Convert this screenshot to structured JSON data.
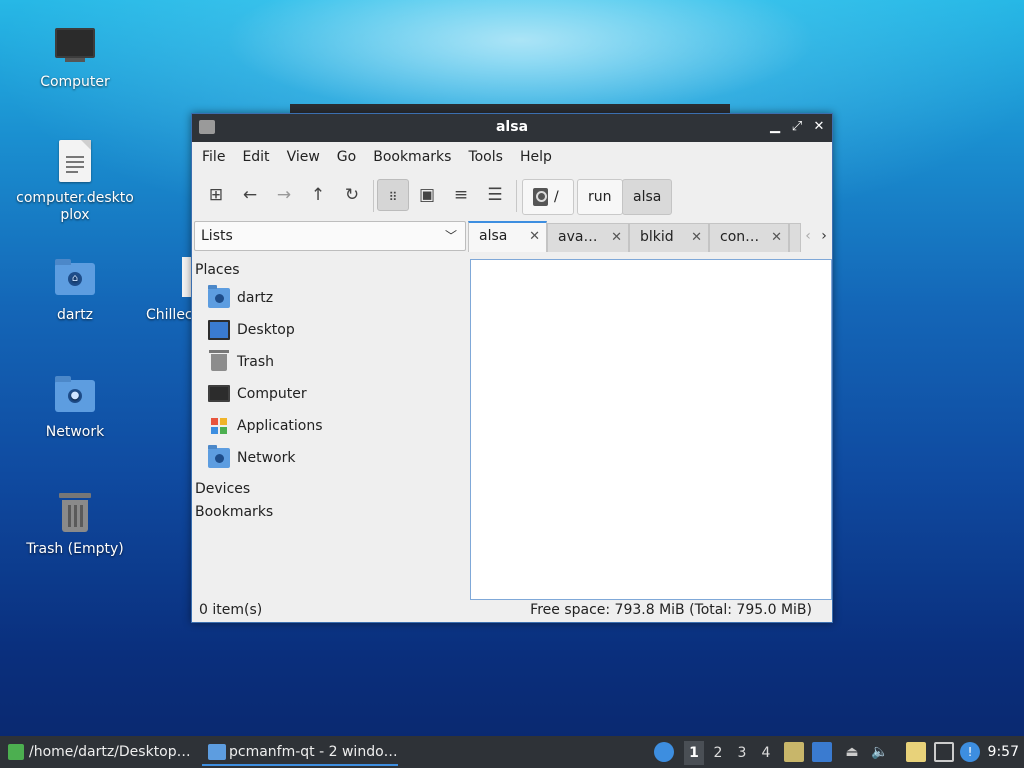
{
  "desktop": {
    "icons": [
      {
        "label": "Computer"
      },
      {
        "label": "computer.desktoplox"
      },
      {
        "label": "dartz"
      },
      {
        "label": "Chillec"
      },
      {
        "label": "Network"
      },
      {
        "label": "Trash (Empty)"
      }
    ]
  },
  "window": {
    "title": "alsa",
    "menu": [
      "File",
      "Edit",
      "View",
      "Go",
      "Bookmarks",
      "Tools",
      "Help"
    ],
    "pathbar": {
      "root": "/",
      "crumbs": [
        "run",
        "alsa"
      ]
    },
    "side_pane_mode": "Lists",
    "tabs": [
      {
        "label": "alsa"
      },
      {
        "label": "ava…"
      },
      {
        "label": "blkid"
      },
      {
        "label": "con…"
      }
    ],
    "sidebar": {
      "places_header": "Places",
      "places": [
        "dartz",
        "Desktop",
        "Trash",
        "Computer",
        "Applications",
        "Network"
      ],
      "devices_header": "Devices",
      "bookmarks_header": "Bookmarks"
    },
    "status": {
      "items": "0 item(s)",
      "free_space": "Free space: 793.8 MiB (Total: 795.0 MiB)"
    }
  },
  "taskbar": {
    "tasks": [
      {
        "label": "/home/dartz/Desktop…"
      },
      {
        "label": "pcmanfm-qt - 2 windo…"
      }
    ],
    "desktops": [
      "1",
      "2",
      "3",
      "4"
    ],
    "active_desktop": "1",
    "clock": "9:57"
  },
  "colors": {
    "accent": "#3d8ee0",
    "titlebar": "#2f3338",
    "taskbar": "#2e3237",
    "folder": "#5d9de0"
  }
}
